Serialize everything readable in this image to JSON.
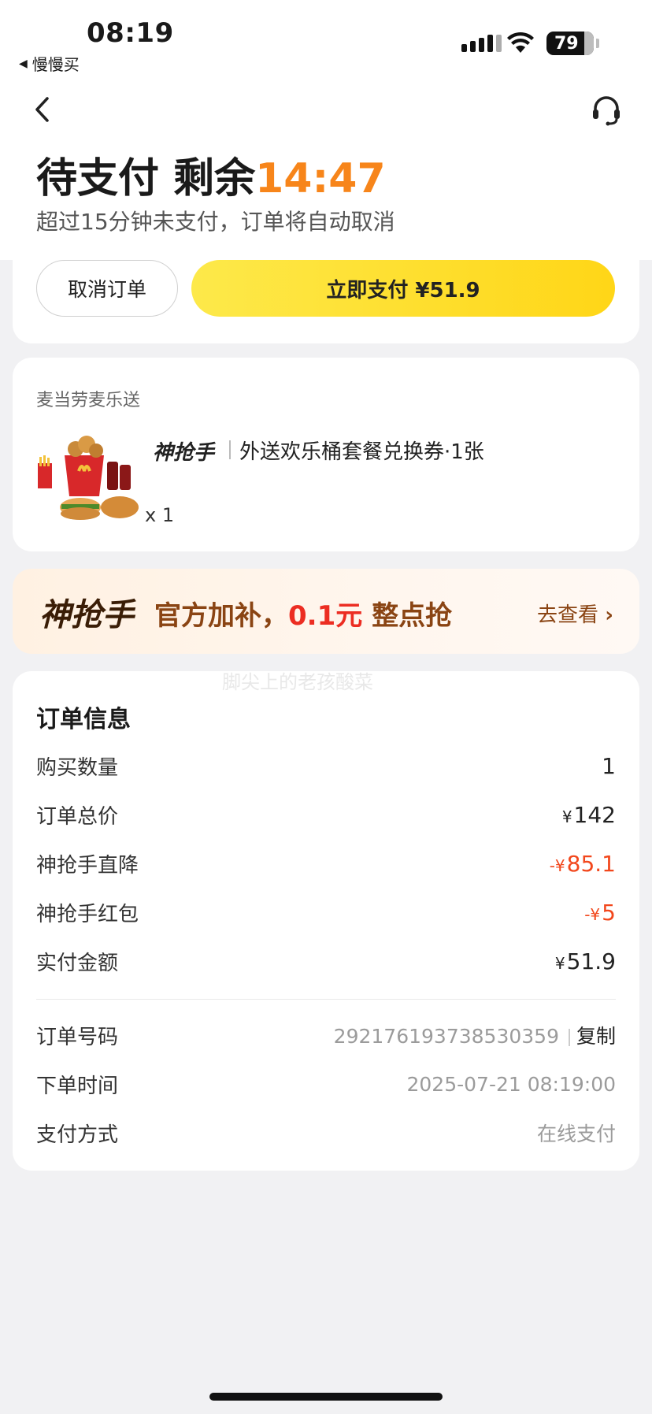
{
  "status_bar": {
    "time": "08:19",
    "back_app": "慢慢买",
    "battery": "79"
  },
  "header": {
    "status_prefix": "待支付 剩余",
    "countdown": "14:47",
    "notice": "超过15分钟未支付，订单将自动取消",
    "cancel_label": "取消订单",
    "pay_label": "立即支付 ¥51.9",
    "countdown_color": "#f7851a",
    "pay_button_color": "#ffd617"
  },
  "product": {
    "store": "麦当劳麦乐送",
    "brand": "神抢手",
    "title": "外送欢乐桶套餐兑换券·1张",
    "qty": "x 1"
  },
  "promo": {
    "logo": "神抢手",
    "text_prefix": "官方加补，",
    "highlight": "0.1元",
    "text_suffix": " 整点抢",
    "link": "去查看"
  },
  "watermark": "脚尖上的老孩酸菜",
  "order_info": {
    "title": "订单信息",
    "rows": [
      {
        "label": "购买数量",
        "value": "1",
        "prefix": ""
      },
      {
        "label": "订单总价",
        "value": "142",
        "prefix": "¥"
      },
      {
        "label": "神抢手直降",
        "value": "85.1",
        "prefix": "-¥"
      },
      {
        "label": "神抢手红包",
        "value": "5",
        "prefix": "-¥"
      },
      {
        "label": "实付金额",
        "value": "51.9",
        "prefix": "¥"
      }
    ],
    "meta": [
      {
        "label": "订单号码",
        "value": "292176193738530359",
        "action": "复制"
      },
      {
        "label": "下单时间",
        "value": "2025-07-21 08:19:00"
      },
      {
        "label": "支付方式",
        "value": "在线支付"
      }
    ],
    "discount_color": "#f2471c"
  }
}
